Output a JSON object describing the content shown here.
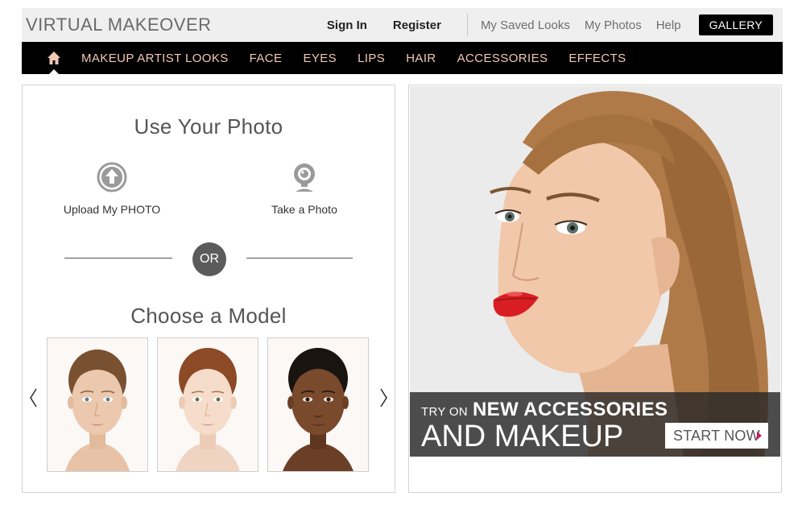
{
  "header": {
    "brand": "VIRTUAL MAKEOVER",
    "sign_in": "Sign In",
    "register": "Register",
    "saved_looks": "My Saved Looks",
    "my_photos": "My Photos",
    "help": "Help",
    "gallery": "GALLERY"
  },
  "nav": {
    "items": [
      {
        "label": "MAKEUP ARTIST LOOKS"
      },
      {
        "label": "FACE"
      },
      {
        "label": "EYES"
      },
      {
        "label": "LIPS"
      },
      {
        "label": "HAIR"
      },
      {
        "label": "ACCESSORIES"
      },
      {
        "label": "EFFECTS"
      }
    ]
  },
  "left": {
    "use_photo_title": "Use Your Photo",
    "upload_label": "Upload My PHOTO",
    "take_photo_label": "Take a Photo",
    "or_label": "OR",
    "choose_model_title": "Choose a Model"
  },
  "promo": {
    "try_on": "TRY ON",
    "headline": "NEW ACCESSORIES",
    "subline": "AND MAKEUP",
    "cta": "START NOW"
  },
  "colors": {
    "nav_text": "#f1c9b5",
    "cta_arrow": "#c2185b",
    "lip": "#d81e23"
  }
}
